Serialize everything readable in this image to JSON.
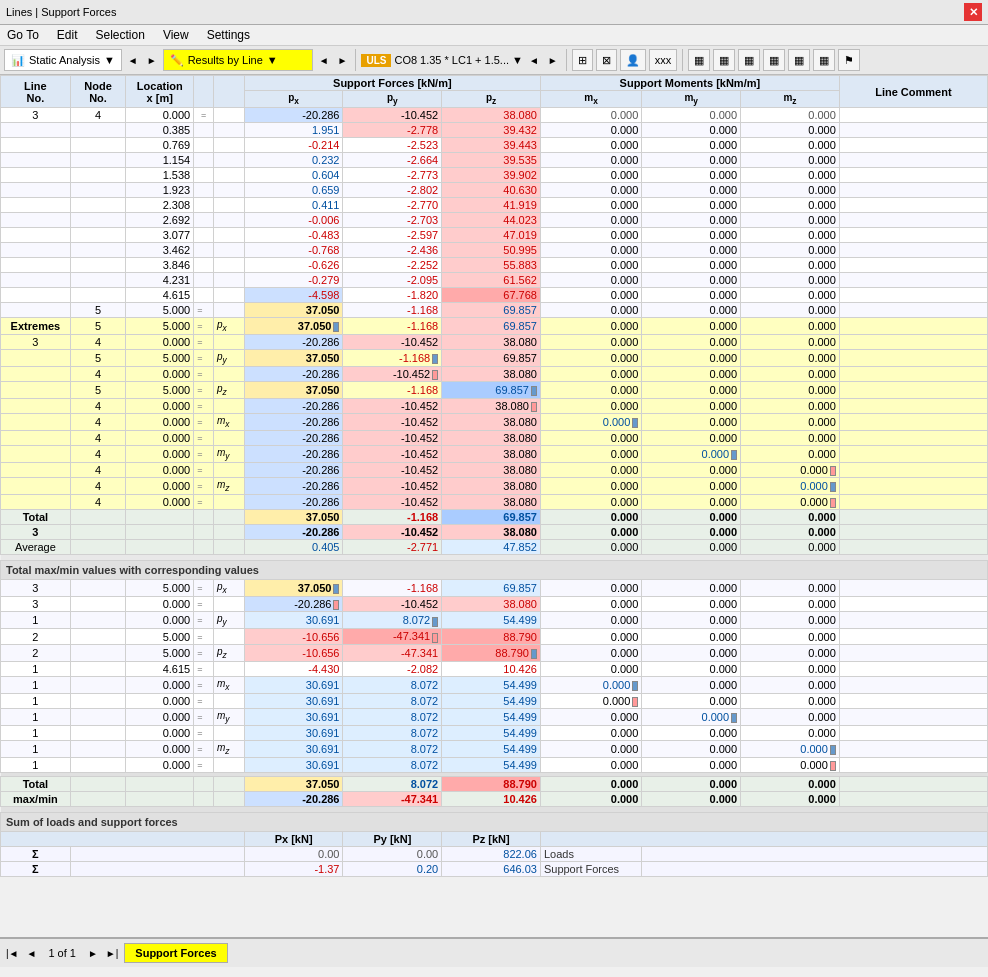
{
  "window": {
    "title": "Lines | Support Forces",
    "close_label": "✕"
  },
  "menu": {
    "items": [
      "Go To",
      "Edit",
      "Selection",
      "View",
      "Settings"
    ]
  },
  "toolbar": {
    "analysis_label": "Static Analysis",
    "results_label": "Results by Line",
    "nav_prev": "◄",
    "nav_next": "►",
    "uls_label": "ULS",
    "combo_label": "CO8",
    "combo_formula": "1.35 * LC1 + 1.5...",
    "icons": [
      "⊞",
      "⊠",
      "👤",
      "xxx",
      "▦",
      "▦",
      "▦",
      "▦",
      "▦",
      "▦",
      "⚑"
    ]
  },
  "table": {
    "headers": {
      "support_forces": "Support Forces [kN/m]",
      "support_moments": "Support Moments [kNm/m]",
      "line_no": "Line No.",
      "node_no": "Node No.",
      "location": "Location x [m]",
      "px": "px",
      "py": "py",
      "pz": "pz",
      "mx": "mx",
      "my": "my",
      "mz": "mz",
      "comment": "Line Comment"
    }
  },
  "sections": {
    "total_maxmin": "Total max/min values with corresponding values",
    "sum_loads": "Sum of loads and support forces",
    "px_kn": "Px [kN]",
    "py_kn": "Py [kN]",
    "pz_kn": "Pz [kN]"
  },
  "sum_rows": [
    {
      "sigma": "Σ",
      "px": "0.00",
      "py": "0.00",
      "pz": "822.06",
      "label": "Loads"
    },
    {
      "sigma": "Σ",
      "px": "-1.37",
      "py": "0.20",
      "pz": "646.03",
      "label": "Support Forces"
    }
  ],
  "bottom_tab": {
    "page": "1 of 1",
    "tab_label": "Support Forces"
  }
}
